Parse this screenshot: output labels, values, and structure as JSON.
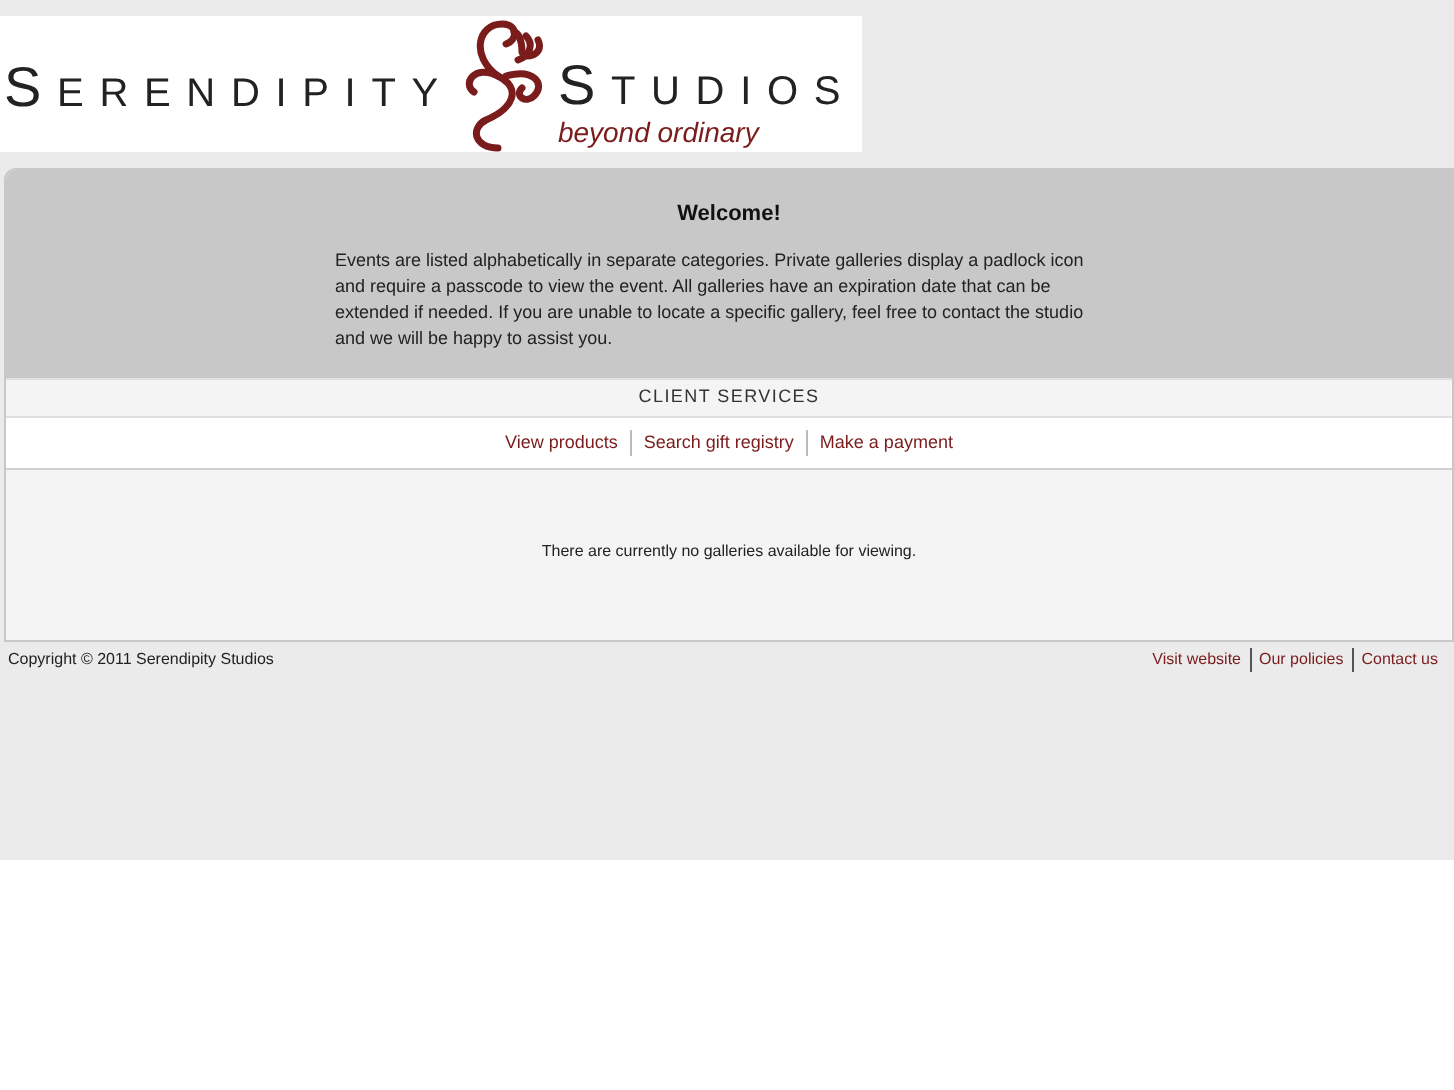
{
  "logo": {
    "name_left": "Serendipity",
    "name_right": "Studios",
    "tagline": "beyond ordinary"
  },
  "welcome": {
    "title": "Welcome!",
    "text": "Events are listed alphabetically in separate categories. Private galleries display a padlock icon and require a passcode to view the event. All galleries have an expiration date that can be extended if needed. If you are unable to locate a specific gallery, feel free to contact the studio and we will be happy to assist you."
  },
  "client_services": {
    "title": "CLIENT SERVICES",
    "links": [
      "View products",
      "Search gift registry",
      "Make a payment"
    ]
  },
  "galleries": {
    "message": "There are currently no galleries available for viewing."
  },
  "footer": {
    "copyright": "Copyright © 2011 Serendipity Studios",
    "links": [
      "Visit website",
      "Our policies",
      "Contact us"
    ]
  }
}
